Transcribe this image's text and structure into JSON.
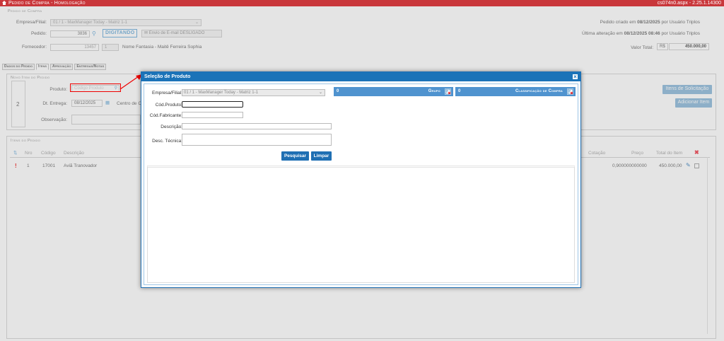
{
  "titlebar": {
    "title": "Pedido de Compra  - Homologação",
    "version": "cs074n0.aspx - 2.25.1.14300"
  },
  "header": {
    "section": "Pedido de Compra",
    "empresa_label": "Empresa/Filial:",
    "empresa_value": "01 / 1 - MaxManager Today - Matriz 1-1",
    "pedido_label": "Pedido:",
    "pedido_value": "3836",
    "status_badge": "DIGITANDO",
    "email_status": "Envio de E-mail DESLIGADO",
    "fornecedor_label": "Fornecedor:",
    "fornecedor_code": "13457",
    "fornecedor_seq": "1",
    "fornecedor_name": "Nome Fantasia - Maitê Ferreira Sophia",
    "created_text": "Pedido criado em",
    "created_date": "08/12/2025",
    "created_by": "por Usuário Triplos",
    "changed_text": "Última alteração em",
    "changed_date": "08/12/2025 08:46",
    "changed_by": "por Usuário Triplos",
    "valor_label": "Valor Total:",
    "currency": "R$",
    "valor_value": "450.000,00"
  },
  "tabs": [
    "Dados do Pedido",
    "Itens",
    "Aprovação",
    "Entregas/Notas"
  ],
  "novo_item": {
    "section": "Novo Item do Pedido",
    "line_no": "2",
    "produto_label": "Produto:",
    "produto_placeholder": "Código Produto",
    "entrega_label": "Dt. Entrega:",
    "entrega_value": "08/12/2025",
    "centro_label": "Centro de C",
    "obs_label": "Observação:",
    "btn_solicitacao": "Itens de Solicitação",
    "btn_adicionar": "Adicionar Item"
  },
  "itens": {
    "section": "Itens do Pedido",
    "columns": [
      "Nro",
      "Código",
      "Descrição",
      "Cotação",
      "Preço",
      "Total do Item"
    ],
    "rows": [
      {
        "nro": "1",
        "codigo": "17001",
        "descricao": "Aviã Tranovador",
        "preco": "0,900000000000",
        "total": "450.000,00"
      }
    ]
  },
  "modal": {
    "title": "Seleção de Produto",
    "empresa_label": "Empresa/Filial:",
    "empresa_value": "01 / 1 - MaxManager Today - Matriz 1-1",
    "codproduto_label": "Cód.Produto:",
    "codfabricante_label": "Cód.Fabricante:",
    "descricao_label": "Descrição:",
    "desctecnica_label": "Desc. Técnica:",
    "grupo_count": "0",
    "grupo_label": "Grupo",
    "classificacao_count": "0",
    "classificacao_label": "Classificação de Compra",
    "btn_pesquisar": "Pesquisar",
    "btn_limpar": "Limpar"
  },
  "colors": {
    "titlebar": "#c9373b",
    "modal_header": "#1b73b8",
    "filter_bar": "#4f93cf",
    "annotation": "#e00000"
  }
}
